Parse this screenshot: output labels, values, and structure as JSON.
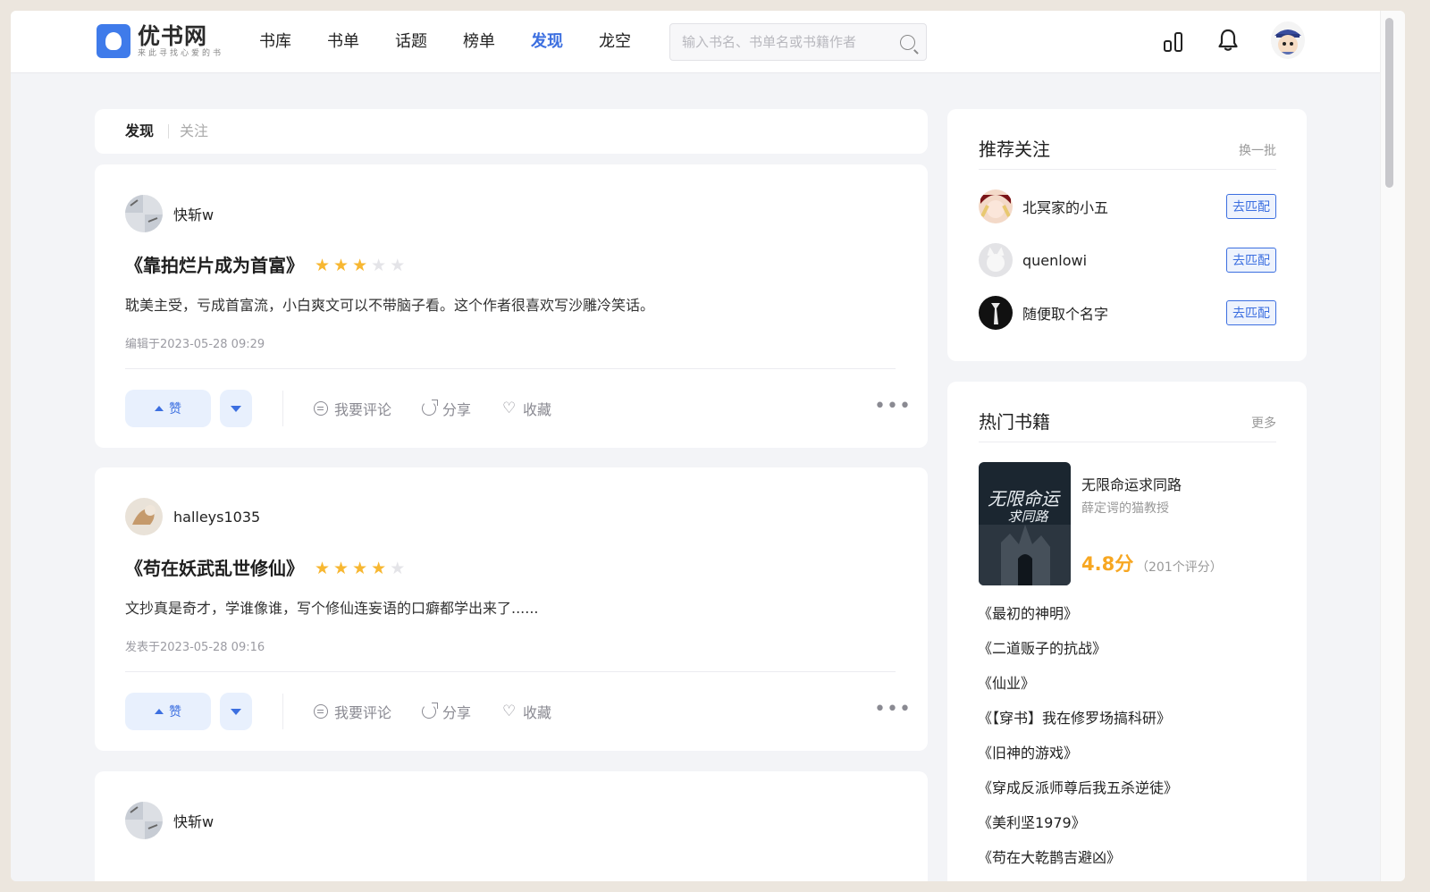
{
  "header": {
    "logo_title": "优书网",
    "logo_sub": "来此寻找心爱的书",
    "nav": [
      "书库",
      "书单",
      "话题",
      "榜单",
      "发现",
      "龙空"
    ],
    "active_nav": "发现",
    "search_placeholder": "输入书名、书单名或书籍作者",
    "icons": [
      "stats-icon",
      "bell-icon",
      "avatar"
    ]
  },
  "feed_tabs": {
    "discover": "发现",
    "follow": "关注"
  },
  "posts": [
    {
      "user": "快斩w",
      "title": "《靠拍烂片成为首富》",
      "rating": 3,
      "text": "耽美主受，亏成首富流，小白爽文可以不带脑子看。这个作者很喜欢写沙雕冷笑话。",
      "time": "编辑于2023-05-28 09:29"
    },
    {
      "user": "halleys1035",
      "title": "《苟在妖武乱世修仙》",
      "rating": 4,
      "text": "文抄真是奇才，学谁像谁，写个修仙连妄语的口癖都学出来了......",
      "time": "发表于2023-05-28 09:16"
    },
    {
      "user": "快斩w",
      "title": "",
      "rating": 0,
      "text": "",
      "time": ""
    }
  ],
  "actions": {
    "like": "赞",
    "comment": "我要评论",
    "share": "分享",
    "favorite": "收藏",
    "more": "•••"
  },
  "recommend": {
    "title": "推荐关注",
    "refresh": "换一批",
    "button": "去匹配",
    "users": [
      "北冥家的小五",
      "quenlowi",
      "随便取个名字"
    ]
  },
  "hot_books": {
    "title": "热门书籍",
    "more": "更多",
    "featured": {
      "name": "无限命运求同路",
      "author": "薛定谔的猫教授",
      "score": "4.8分",
      "count": "（201个评分）"
    },
    "list": [
      "《最初的神明》",
      "《二道贩子的抗战》",
      "《仙业》",
      "《【穿书】我在修罗场搞科研》",
      "《旧神的游戏》",
      "《穿成反派师尊后我五杀逆徒》",
      "《美利坚1979》",
      "《苟在大乾鹊吉避凶》"
    ]
  },
  "colors": {
    "accent": "#3c6fe0",
    "star": "#f7b731",
    "score": "#f7a722"
  }
}
